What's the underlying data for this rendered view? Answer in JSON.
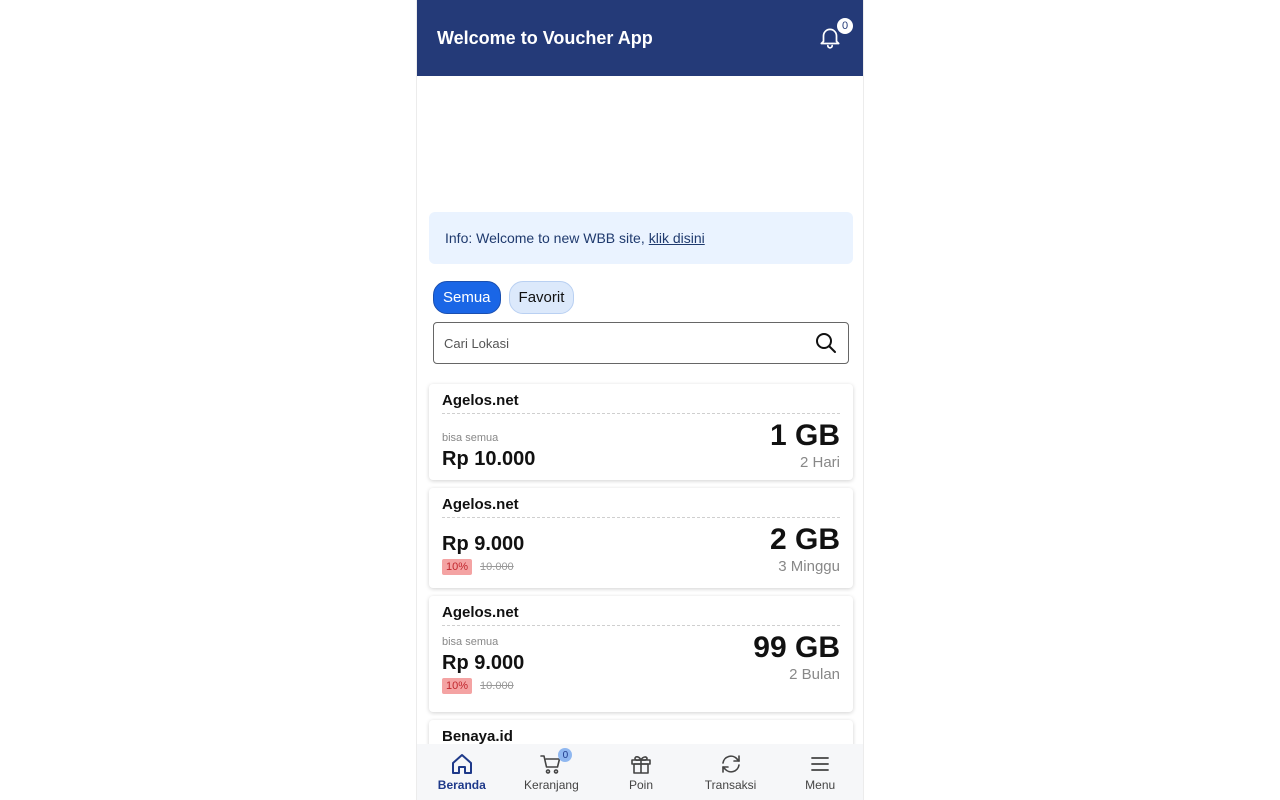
{
  "header": {
    "title": "Welcome to Voucher App",
    "notification_count": "0"
  },
  "info": {
    "text": "Info: Welcome to new WBB site,",
    "link": "klik disini"
  },
  "tabs": [
    {
      "label": "Semua",
      "active": true
    },
    {
      "label": "Favorit",
      "active": false
    }
  ],
  "search": {
    "placeholder": "Cari Lokasi"
  },
  "cards": [
    {
      "name": "Agelos.net",
      "note": "bisa semua",
      "price": "Rp 10.000",
      "discount": "",
      "old_price": "",
      "size": "1 GB",
      "duration": "2 Hari"
    },
    {
      "name": "Agelos.net",
      "note": "",
      "price": "Rp 9.000",
      "discount": "10%",
      "old_price": "10.000",
      "size": "2 GB",
      "duration": "3 Minggu"
    },
    {
      "name": "Agelos.net",
      "note": "bisa semua",
      "price": "Rp 9.000",
      "discount": "10%",
      "old_price": "10.000",
      "size": "99 GB",
      "duration": "2 Bulan"
    },
    {
      "name": "Benaya.id"
    }
  ],
  "nav": {
    "items": [
      {
        "label": "Beranda",
        "icon": "home-icon",
        "active": true
      },
      {
        "label": "Keranjang",
        "icon": "cart-icon",
        "badge": "0"
      },
      {
        "label": "Poin",
        "icon": "gift-icon"
      },
      {
        "label": "Transaksi",
        "icon": "refresh-icon"
      },
      {
        "label": "Menu",
        "icon": "menu-icon"
      }
    ]
  },
  "colors": {
    "header": "#243a78",
    "accent": "#1a66e6",
    "info_bg": "#eaf3ff"
  }
}
